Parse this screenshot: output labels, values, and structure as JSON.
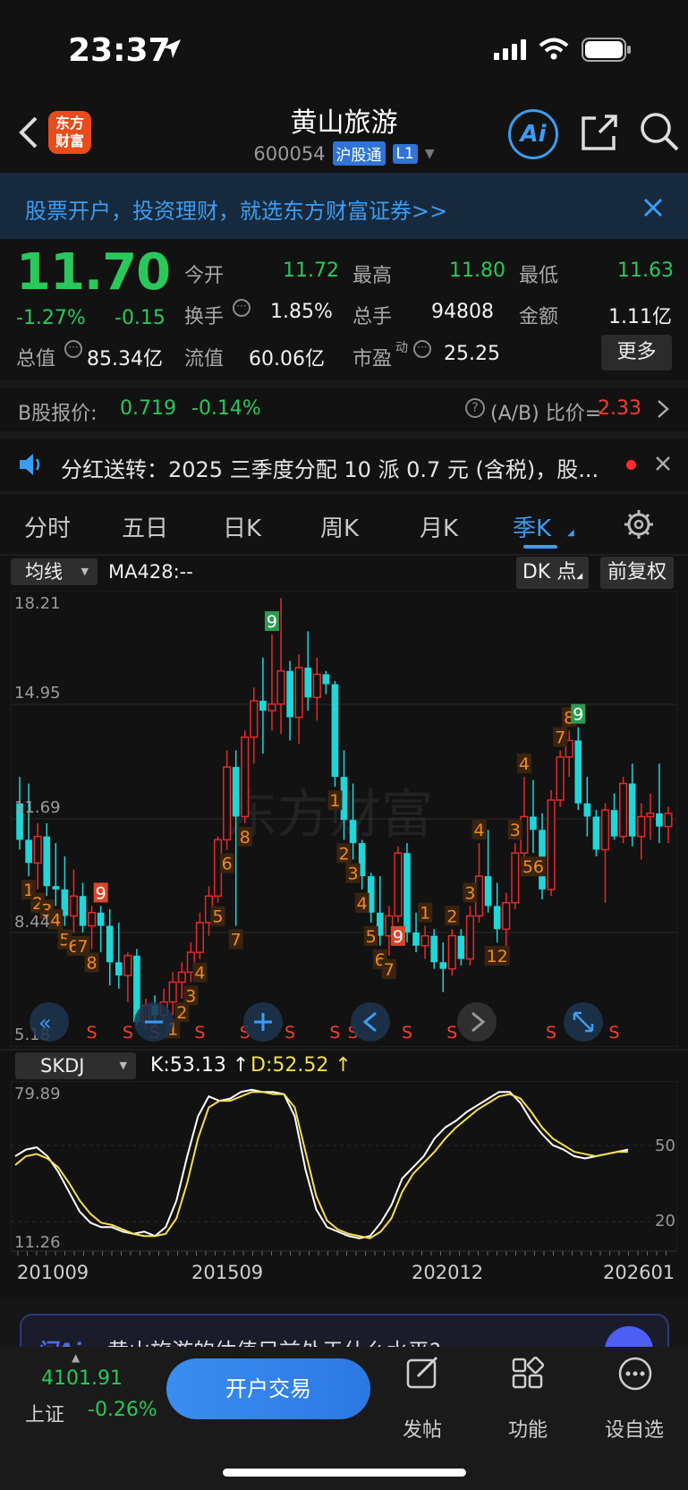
{
  "status_bar": {
    "time": "23:37"
  },
  "header": {
    "title": "黄山旅游",
    "code": "600054",
    "tag": "沪股通",
    "level": "L1",
    "logo_text_1": "东方",
    "logo_text_2": "财富",
    "ai_label": "Ai"
  },
  "banner": {
    "text": "股票开户，投资理财，就选东方财富证券>>"
  },
  "quote": {
    "price": "11.70",
    "change_pct": "-1.27%",
    "change": "-0.15",
    "open_label": "今开",
    "open": "11.72",
    "high_label": "最高",
    "high": "11.80",
    "low_label": "最低",
    "low": "11.63",
    "turnover_label": "换手",
    "turnover": "1.85%",
    "volume_label": "总手",
    "volume": "94808",
    "amount_label": "金额",
    "amount": "1.11亿",
    "mktcap_label": "总值",
    "mktcap": "85.34亿",
    "float_label": "流值",
    "float": "60.06亿",
    "pe_label": "市盈",
    "pe_sup": "动",
    "pe": "25.25",
    "more_label": "更多"
  },
  "bshare": {
    "label": "B股报价:",
    "price": "0.719",
    "change": "-0.14%",
    "ratio_label": "(A/B) 比价=",
    "ratio": "2.33"
  },
  "notice": {
    "text": "分红送转：2025 三季度分配 10 派 0.7 元 (含税)，股..."
  },
  "tabs": [
    "分时",
    "五日",
    "日K",
    "周K",
    "月K",
    "季K"
  ],
  "active_tab": "季K",
  "chart_toolbar": {
    "indicator": "均线",
    "ma_text": "MA428:--",
    "dk_label": "DK 点",
    "adjust_label": "前复权"
  },
  "watermark": "东方财富",
  "sub_indicator": {
    "name": "SKDJ",
    "k_text": "K:53.13",
    "d_text": "D:52.52"
  },
  "colors": {
    "up": "#e8282b",
    "down": "#1fd6d8",
    "k_line": "#ffffff",
    "d_line": "#f4e04d",
    "accent": "#3c9cf2"
  },
  "chart_data": [
    {
      "type": "candlestick",
      "y_tick_labels": [
        "18.21",
        "14.95",
        "11.69",
        "8.44",
        "5.18"
      ],
      "ylim": [
        5.18,
        18.21
      ],
      "x_tick_labels": [
        "201009",
        "201509",
        "202012",
        "202601"
      ],
      "sequence_labels": [
        "1",
        "2",
        "3",
        "4",
        "5",
        "6",
        "7",
        "8",
        "9",
        "1",
        "2",
        "3",
        "4",
        "5",
        "6",
        "7",
        "8",
        "9",
        "1",
        "2",
        "3",
        "4",
        "5",
        "6",
        "7",
        "8",
        "9",
        "1",
        "2",
        "3",
        "4",
        "12",
        "3",
        "4",
        "56",
        "7",
        "8",
        "9"
      ],
      "signal_label": "S",
      "candles": [
        {
          "o": 12.0,
          "h": 12.8,
          "l": 10.6,
          "c": 10.9
        },
        {
          "o": 10.9,
          "h": 12.6,
          "l": 9.8,
          "c": 10.2
        },
        {
          "o": 10.2,
          "h": 11.4,
          "l": 9.4,
          "c": 11.0
        },
        {
          "o": 11.0,
          "h": 11.4,
          "l": 9.2,
          "c": 9.5
        },
        {
          "o": 9.5,
          "h": 10.8,
          "l": 8.9,
          "c": 9.4
        },
        {
          "o": 9.4,
          "h": 10.4,
          "l": 8.3,
          "c": 8.6
        },
        {
          "o": 8.6,
          "h": 10.0,
          "l": 8.1,
          "c": 9.2
        },
        {
          "o": 9.2,
          "h": 9.6,
          "l": 8.1,
          "c": 8.3
        },
        {
          "o": 8.3,
          "h": 8.9,
          "l": 7.6,
          "c": 8.7
        },
        {
          "o": 8.7,
          "h": 8.9,
          "l": 7.5,
          "c": 8.3
        },
        {
          "o": 8.3,
          "h": 8.8,
          "l": 6.5,
          "c": 7.2
        },
        {
          "o": 7.2,
          "h": 8.4,
          "l": 6.4,
          "c": 6.8
        },
        {
          "o": 6.8,
          "h": 7.5,
          "l": 6.0,
          "c": 7.4
        },
        {
          "o": 7.4,
          "h": 7.6,
          "l": 5.3,
          "c": 5.4
        },
        {
          "o": 5.4,
          "h": 6.1,
          "l": 5.2,
          "c": 5.9
        },
        {
          "o": 5.9,
          "h": 6.2,
          "l": 5.3,
          "c": 5.6
        },
        {
          "o": 5.6,
          "h": 6.4,
          "l": 5.4,
          "c": 6.0
        },
        {
          "o": 6.0,
          "h": 6.9,
          "l": 5.6,
          "c": 6.6
        },
        {
          "o": 6.6,
          "h": 7.2,
          "l": 6.1,
          "c": 6.9
        },
        {
          "o": 6.9,
          "h": 7.8,
          "l": 6.6,
          "c": 7.5
        },
        {
          "o": 7.5,
          "h": 8.7,
          "l": 7.3,
          "c": 8.4
        },
        {
          "o": 8.4,
          "h": 9.5,
          "l": 8.0,
          "c": 9.2
        },
        {
          "o": 9.2,
          "h": 11.0,
          "l": 9.0,
          "c": 10.9
        },
        {
          "o": 10.9,
          "h": 13.6,
          "l": 10.6,
          "c": 13.1
        },
        {
          "o": 13.1,
          "h": 13.6,
          "l": 8.3,
          "c": 11.6
        },
        {
          "o": 11.6,
          "h": 14.2,
          "l": 11.4,
          "c": 14.0
        },
        {
          "o": 14.0,
          "h": 15.5,
          "l": 13.2,
          "c": 15.1
        },
        {
          "o": 15.1,
          "h": 16.4,
          "l": 13.5,
          "c": 14.8
        },
        {
          "o": 14.8,
          "h": 17.1,
          "l": 14.2,
          "c": 15.0
        },
        {
          "o": 15.0,
          "h": 18.2,
          "l": 14.1,
          "c": 16.0
        },
        {
          "o": 16.0,
          "h": 16.3,
          "l": 13.9,
          "c": 14.6
        },
        {
          "o": 14.6,
          "h": 16.5,
          "l": 13.8,
          "c": 16.1
        },
        {
          "o": 16.1,
          "h": 17.2,
          "l": 14.8,
          "c": 15.2
        },
        {
          "o": 15.2,
          "h": 16.4,
          "l": 14.5,
          "c": 15.9
        },
        {
          "o": 15.9,
          "h": 16.0,
          "l": 15.3,
          "c": 15.6
        },
        {
          "o": 15.6,
          "h": 15.7,
          "l": 12.5,
          "c": 12.8
        },
        {
          "o": 12.8,
          "h": 13.6,
          "l": 10.9,
          "c": 11.5
        },
        {
          "o": 11.5,
          "h": 12.6,
          "l": 10.3,
          "c": 10.8
        },
        {
          "o": 10.8,
          "h": 10.9,
          "l": 9.4,
          "c": 9.8
        },
        {
          "o": 9.8,
          "h": 9.9,
          "l": 8.4,
          "c": 8.7
        },
        {
          "o": 8.7,
          "h": 9.8,
          "l": 7.7,
          "c": 8.0
        },
        {
          "o": 8.0,
          "h": 8.9,
          "l": 7.4,
          "c": 8.6
        },
        {
          "o": 8.6,
          "h": 10.7,
          "l": 8.4,
          "c": 10.5
        },
        {
          "o": 10.5,
          "h": 10.8,
          "l": 7.8,
          "c": 8.1
        },
        {
          "o": 8.1,
          "h": 8.7,
          "l": 7.5,
          "c": 7.7
        },
        {
          "o": 7.7,
          "h": 8.3,
          "l": 7.3,
          "c": 8.0
        },
        {
          "o": 8.0,
          "h": 8.2,
          "l": 7.0,
          "c": 7.2
        },
        {
          "o": 7.2,
          "h": 7.8,
          "l": 6.3,
          "c": 7.0
        },
        {
          "o": 7.0,
          "h": 8.2,
          "l": 6.8,
          "c": 8.0
        },
        {
          "o": 8.0,
          "h": 8.2,
          "l": 7.1,
          "c": 7.3
        },
        {
          "o": 7.3,
          "h": 8.9,
          "l": 7.1,
          "c": 8.6
        },
        {
          "o": 8.6,
          "h": 10.8,
          "l": 8.4,
          "c": 9.8
        },
        {
          "o": 9.8,
          "h": 11.2,
          "l": 8.7,
          "c": 8.9
        },
        {
          "o": 8.9,
          "h": 9.6,
          "l": 7.8,
          "c": 8.2
        },
        {
          "o": 8.2,
          "h": 9.3,
          "l": 7.5,
          "c": 9.0
        },
        {
          "o": 9.0,
          "h": 10.8,
          "l": 8.8,
          "c": 10.5
        },
        {
          "o": 10.5,
          "h": 12.8,
          "l": 10.3,
          "c": 11.6
        },
        {
          "o": 11.6,
          "h": 12.7,
          "l": 10.5,
          "c": 11.2
        },
        {
          "o": 11.2,
          "h": 11.7,
          "l": 9.1,
          "c": 9.4
        },
        {
          "o": 9.4,
          "h": 12.4,
          "l": 9.2,
          "c": 12.1
        },
        {
          "o": 12.1,
          "h": 13.6,
          "l": 11.9,
          "c": 13.4
        },
        {
          "o": 13.4,
          "h": 14.2,
          "l": 12.8,
          "c": 13.9
        },
        {
          "o": 13.9,
          "h": 14.3,
          "l": 11.8,
          "c": 12.0
        },
        {
          "o": 12.0,
          "h": 12.8,
          "l": 11.0,
          "c": 11.6
        },
        {
          "o": 11.6,
          "h": 11.8,
          "l": 10.4,
          "c": 10.6
        },
        {
          "o": 10.6,
          "h": 12.0,
          "l": 9.0,
          "c": 11.8
        },
        {
          "o": 11.8,
          "h": 12.3,
          "l": 10.9,
          "c": 11.0
        },
        {
          "o": 11.0,
          "h": 12.8,
          "l": 10.8,
          "c": 12.6
        },
        {
          "o": 12.6,
          "h": 13.2,
          "l": 10.7,
          "c": 11.0
        },
        {
          "o": 11.0,
          "h": 12.0,
          "l": 10.3,
          "c": 11.6
        },
        {
          "o": 11.6,
          "h": 12.3,
          "l": 10.9,
          "c": 11.7
        },
        {
          "o": 11.7,
          "h": 13.2,
          "l": 10.8,
          "c": 11.3
        },
        {
          "o": 11.3,
          "h": 11.9,
          "l": 10.8,
          "c": 11.7
        }
      ]
    },
    {
      "type": "line",
      "name": "SKDJ",
      "y_tick_labels": [
        "79.89",
        "50",
        "20",
        "11.26"
      ],
      "ylim": [
        11.26,
        79.89
      ],
      "series": [
        {
          "name": "K",
          "values": [
            50,
            53,
            54,
            50,
            43,
            34,
            25,
            20,
            18,
            18,
            16,
            15,
            16,
            14,
            18,
            30,
            50,
            68,
            77,
            75,
            76,
            79,
            80,
            79,
            79,
            78,
            68,
            44,
            26,
            18,
            16,
            14,
            13,
            14,
            20,
            28,
            40,
            45,
            50,
            58,
            63,
            66,
            70,
            73,
            76,
            79,
            79,
            74,
            66,
            60,
            55,
            53,
            50,
            49,
            50,
            51,
            52,
            53
          ]
        },
        {
          "name": "D",
          "values": [
            46,
            50,
            51,
            49,
            45,
            38,
            30,
            24,
            20,
            19,
            17,
            15,
            14,
            14,
            15,
            22,
            38,
            58,
            72,
            75,
            75,
            77,
            79,
            79,
            78,
            78,
            72,
            52,
            32,
            21,
            17,
            15,
            14,
            13,
            16,
            22,
            34,
            42,
            47,
            52,
            58,
            63,
            67,
            71,
            74,
            77,
            78,
            76,
            70,
            63,
            58,
            55,
            52,
            51,
            50,
            51,
            52,
            52
          ]
        }
      ]
    }
  ],
  "ai_prompt": {
    "text": "黄山旅游的估值目前处于什么水平?"
  },
  "bottom_nav": {
    "index_value": "4101.91",
    "index_name": "上证",
    "index_change": "-0.26%",
    "trade_button": "开户交易",
    "post": "发帖",
    "function": "功能",
    "watchlist": "设自选"
  }
}
